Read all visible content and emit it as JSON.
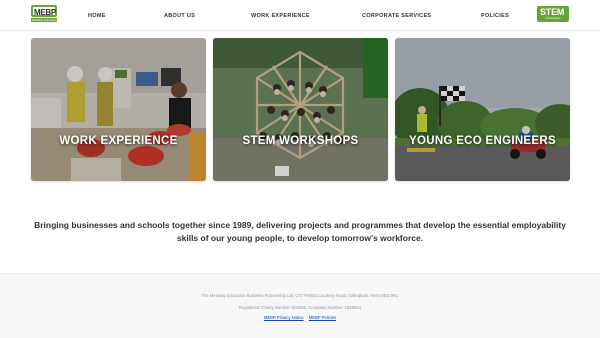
{
  "header": {
    "logo_left": {
      "mark": "MEBP",
      "tagline": "Medway Education Business Partnership"
    },
    "nav": [
      {
        "label": "HOME"
      },
      {
        "label": "ABOUT US"
      },
      {
        "label": "WORK EXPERIENCE"
      },
      {
        "label": "CORPORATE SERVICES"
      },
      {
        "label": "POLICIES"
      }
    ],
    "logo_right": {
      "mark": "STEM",
      "tagline": "Ambassadors"
    }
  },
  "cards": [
    {
      "title": "WORK EXPERIENCE"
    },
    {
      "title": "STEM WORKSHOPS"
    },
    {
      "title": "YOUNG ECO ENGINEERS"
    }
  ],
  "tagline": "Bringing businesses and schools together since 1989, delivering projects and programmes that develop the essential employability skills of our young people, to develop tomorrow's workforce.",
  "footer": {
    "address": "The Medway Education Business Partnership Ltd, C/O Pinfold Courtney Road, Gillingham, Kent ME8 0RU",
    "registration": "Registered Charity Number: 802980, Company Number: 1925824",
    "links": [
      {
        "label": "MEBP Privacy Notice"
      },
      {
        "label": "MEBP Policies"
      }
    ]
  },
  "colors": {
    "brand_green": "#6aa23a",
    "footer_bg": "#f7f7f7",
    "link": "#1a3fb0"
  }
}
